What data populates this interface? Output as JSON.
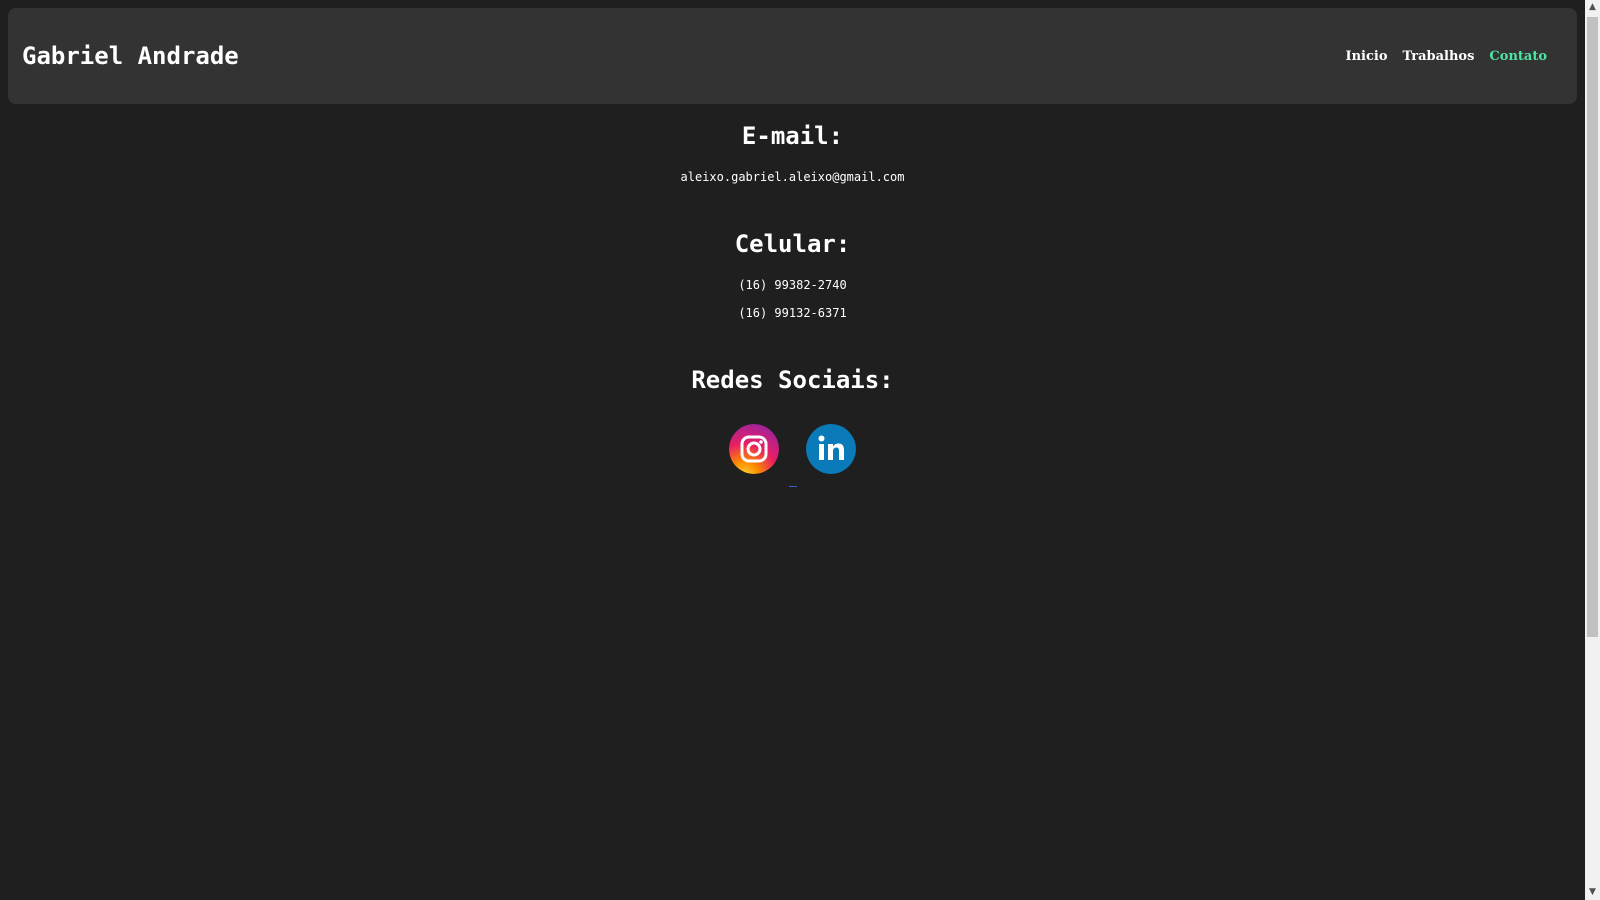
{
  "header": {
    "site_title": "Gabriel Andrade",
    "nav": [
      {
        "label": "Inicio",
        "active": false
      },
      {
        "label": "Trabalhos",
        "active": false
      },
      {
        "label": "Contato",
        "active": true
      }
    ],
    "active_color": "#4fe3a1"
  },
  "contact": {
    "email_title": "E-mail:",
    "email": "aleixo.gabriel.aleixo@gmail.com",
    "phone_title": "Celular:",
    "phones": [
      "(16) 99382-2740",
      "(16) 99132-6371"
    ],
    "social_title": "Redes Sociais:",
    "social": [
      {
        "name": "instagram-icon",
        "color": "#e1306c"
      },
      {
        "name": "linkedin-icon",
        "color": "#0a7ab8"
      }
    ]
  },
  "scrollbar": {
    "up_icon": "▲",
    "down_icon": "▼"
  }
}
